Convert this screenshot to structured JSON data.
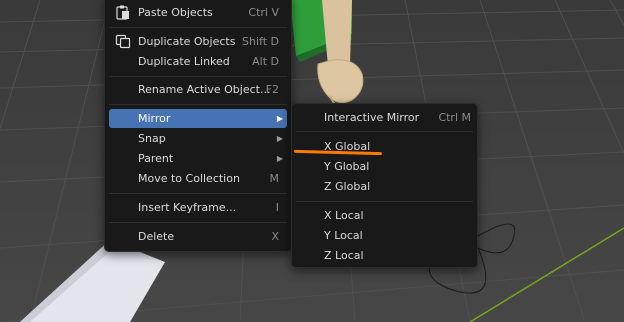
{
  "context_menu": {
    "items": [
      {
        "label": "Paste Objects",
        "shortcut": "Ctrl V",
        "icon": "paste-icon"
      },
      {
        "label": "Duplicate Objects",
        "shortcut": "Shift D",
        "icon": "duplicate-icon"
      },
      {
        "label": "Duplicate Linked",
        "shortcut": "Alt D"
      },
      {
        "label": "Rename Active Object...",
        "shortcut": "F2"
      },
      {
        "label": "Mirror",
        "submenu": true,
        "highlighted": true
      },
      {
        "label": "Snap",
        "submenu": true
      },
      {
        "label": "Parent",
        "submenu": true
      },
      {
        "label": "Move to Collection",
        "shortcut": "M"
      },
      {
        "label": "Insert Keyframe...",
        "shortcut": "I"
      },
      {
        "label": "Delete",
        "shortcut": "X"
      }
    ]
  },
  "mirror_submenu": {
    "items": [
      {
        "label": "Interactive Mirror",
        "shortcut": "Ctrl M"
      },
      {
        "label": "X Global"
      },
      {
        "label": "Y Global"
      },
      {
        "label": "Z Global"
      },
      {
        "label": "X Local"
      },
      {
        "label": "Y Local"
      },
      {
        "label": "Z Local"
      }
    ]
  },
  "colors": {
    "highlight": "#4772b3",
    "annotation": "#ff7a00",
    "grid_x_axis": "#c8303b",
    "grid_y_axis": "#76a61a"
  }
}
